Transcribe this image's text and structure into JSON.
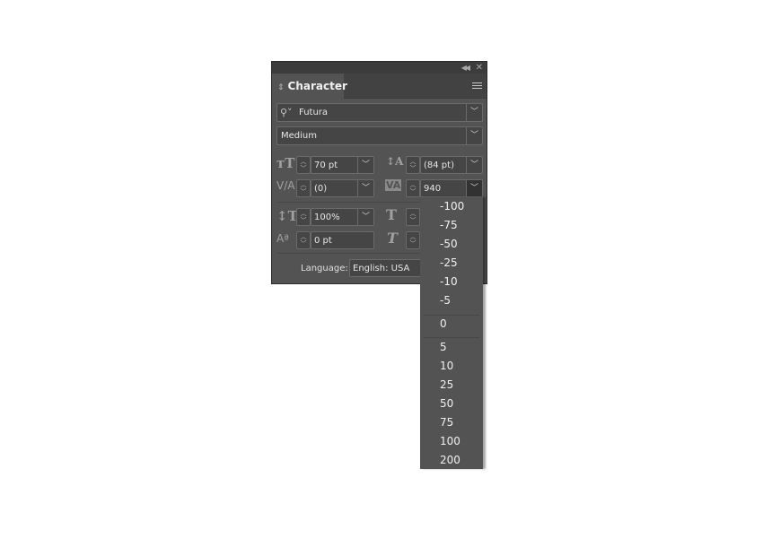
{
  "panel": {
    "tab_title": "Character",
    "font_family": "Futura",
    "font_style": "Medium",
    "font_size": "70 pt",
    "leading": "(84 pt)",
    "kerning": "(0)",
    "tracking": "940",
    "vertical_scale": "100%",
    "horizontal_scale": "",
    "baseline_shift": "0 pt",
    "language_label": "Language:",
    "language_value": "English: USA"
  },
  "tracking_dropdown": {
    "negative": [
      "-100",
      "-75",
      "-50",
      "-25",
      "-10",
      "-5"
    ],
    "zero": "0",
    "positive": [
      "5",
      "10",
      "25",
      "50",
      "75",
      "100",
      "200"
    ]
  }
}
